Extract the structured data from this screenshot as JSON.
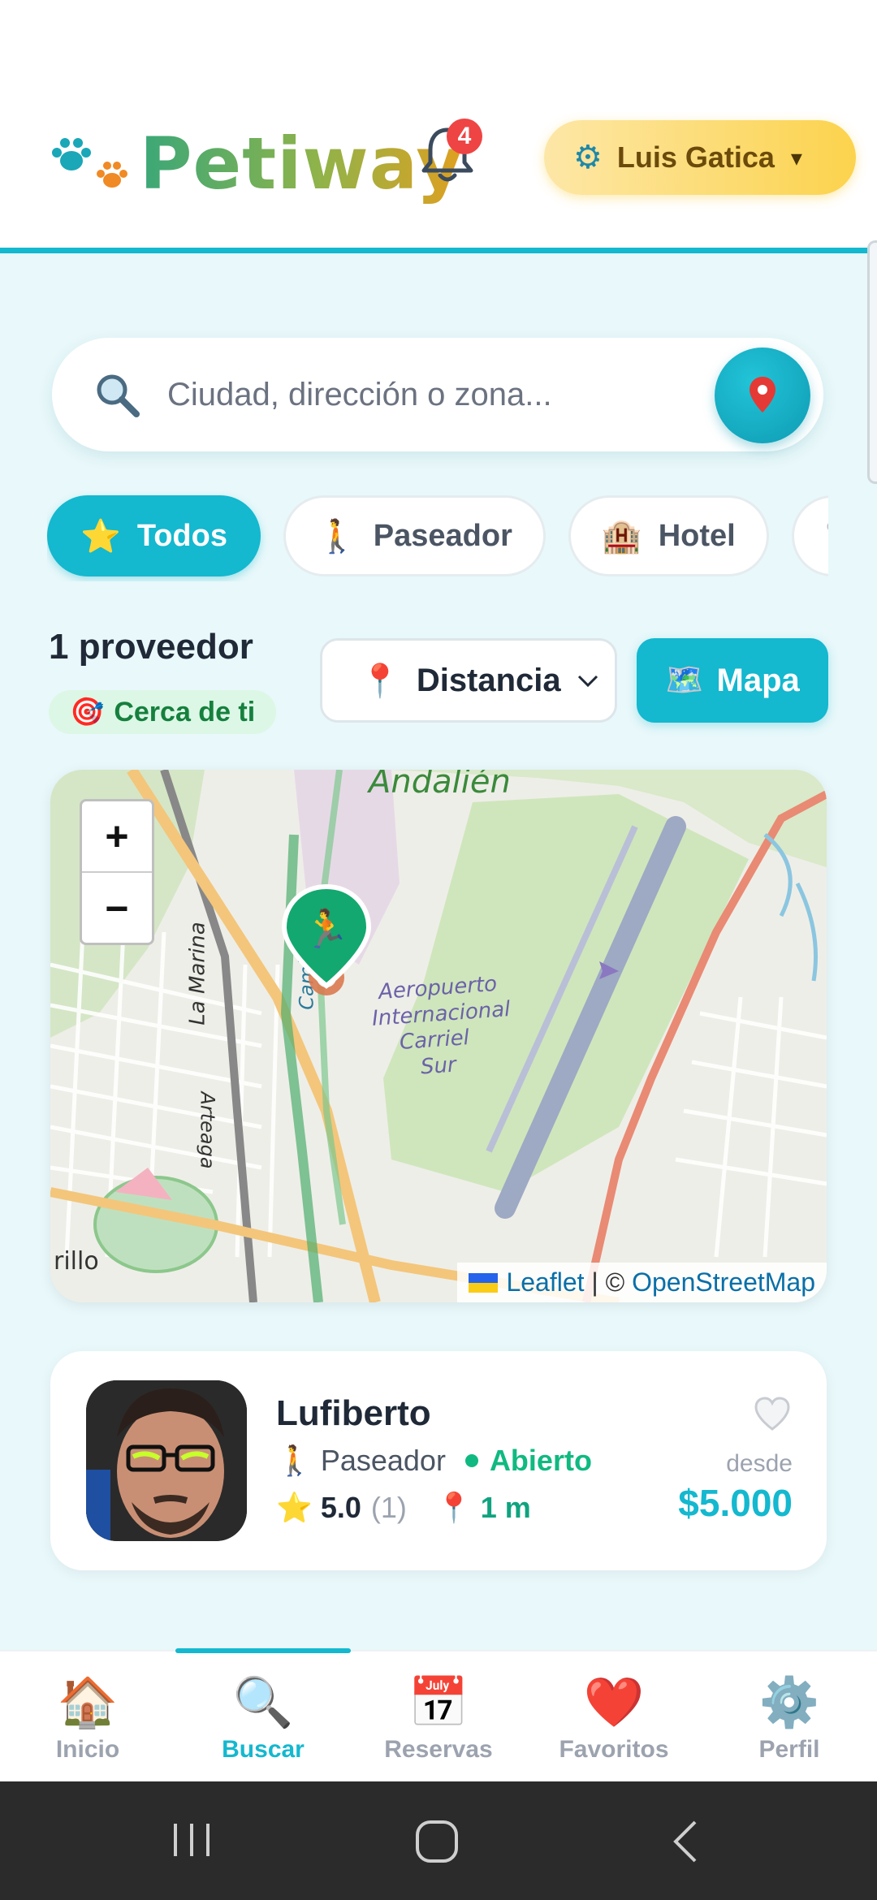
{
  "header": {
    "brand": "Petiway",
    "notifications_count": "4",
    "user_name": "Luis Gatica",
    "user_caret": "▾"
  },
  "search": {
    "placeholder": "Ciudad, dirección o zona..."
  },
  "filters": [
    {
      "icon": "⭐",
      "label": "Todos",
      "active": true
    },
    {
      "icon": "🚶",
      "label": "Paseador",
      "active": false
    },
    {
      "icon": "🏨",
      "label": "Hotel",
      "active": false
    },
    {
      "icon": "🩺",
      "label": "",
      "active": false
    }
  ],
  "results": {
    "count_text": "1 proveedor",
    "near_text": "Cerca de ti",
    "sort_label": "Distancia",
    "map_label": "Mapa"
  },
  "map": {
    "zoom_in": "+",
    "zoom_out": "−",
    "labels": {
      "area": "Andalién",
      "street1": "La Marina",
      "street2": "Arteaga",
      "street3": "Camino",
      "airport1": "Aeropuerto",
      "airport2": "Internacional",
      "airport3": "Carriel",
      "airport4": "Sur",
      "edge": "rillo"
    },
    "attribution": {
      "leaflet": "Leaflet",
      "sep": " | © ",
      "osm": "OpenStreetMap"
    }
  },
  "provider": {
    "name": "Lufiberto",
    "type": "Paseador",
    "status": "Abierto",
    "rating": "5.0",
    "reviews": "(1)",
    "distance": "1 m",
    "price_prefix": "desde",
    "price": "$5.000"
  },
  "bottom_nav": [
    {
      "icon": "🏠",
      "label": "Inicio",
      "active": false
    },
    {
      "icon": "🔍",
      "label": "Buscar",
      "active": true
    },
    {
      "icon": "📅",
      "label": "Reservas",
      "active": false
    },
    {
      "icon": "❤️",
      "label": "Favoritos",
      "active": false
    },
    {
      "icon": "⚙️",
      "label": "Perfil",
      "active": false
    }
  ],
  "colors": {
    "accent": "#14b8cf",
    "open": "#10b981",
    "badge": "#ef4444"
  }
}
